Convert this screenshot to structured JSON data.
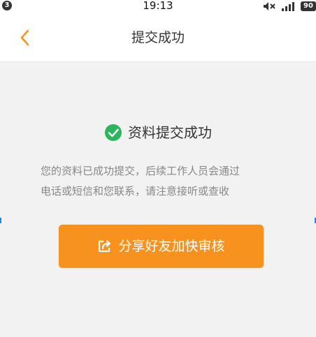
{
  "status_bar": {
    "time": "19:13",
    "notification_count": "3",
    "battery": "90",
    "icons": [
      "mute-icon",
      "signal-icon",
      "battery-icon"
    ]
  },
  "nav": {
    "title": "提交成功",
    "back_icon": "chevron-left-icon"
  },
  "result": {
    "icon": "check-circle-icon",
    "title": "资料提交成功",
    "description_lines": [
      "您的资料已成功提交，后续工作人员会通过",
      "电话或短信和您联系，请注意接听或查收"
    ]
  },
  "share_button": {
    "icon": "share-icon",
    "label": "分享好友加快审核"
  },
  "colors": {
    "accent": "#f7921e",
    "success": "#2db55d",
    "background": "#f2f2f2"
  }
}
